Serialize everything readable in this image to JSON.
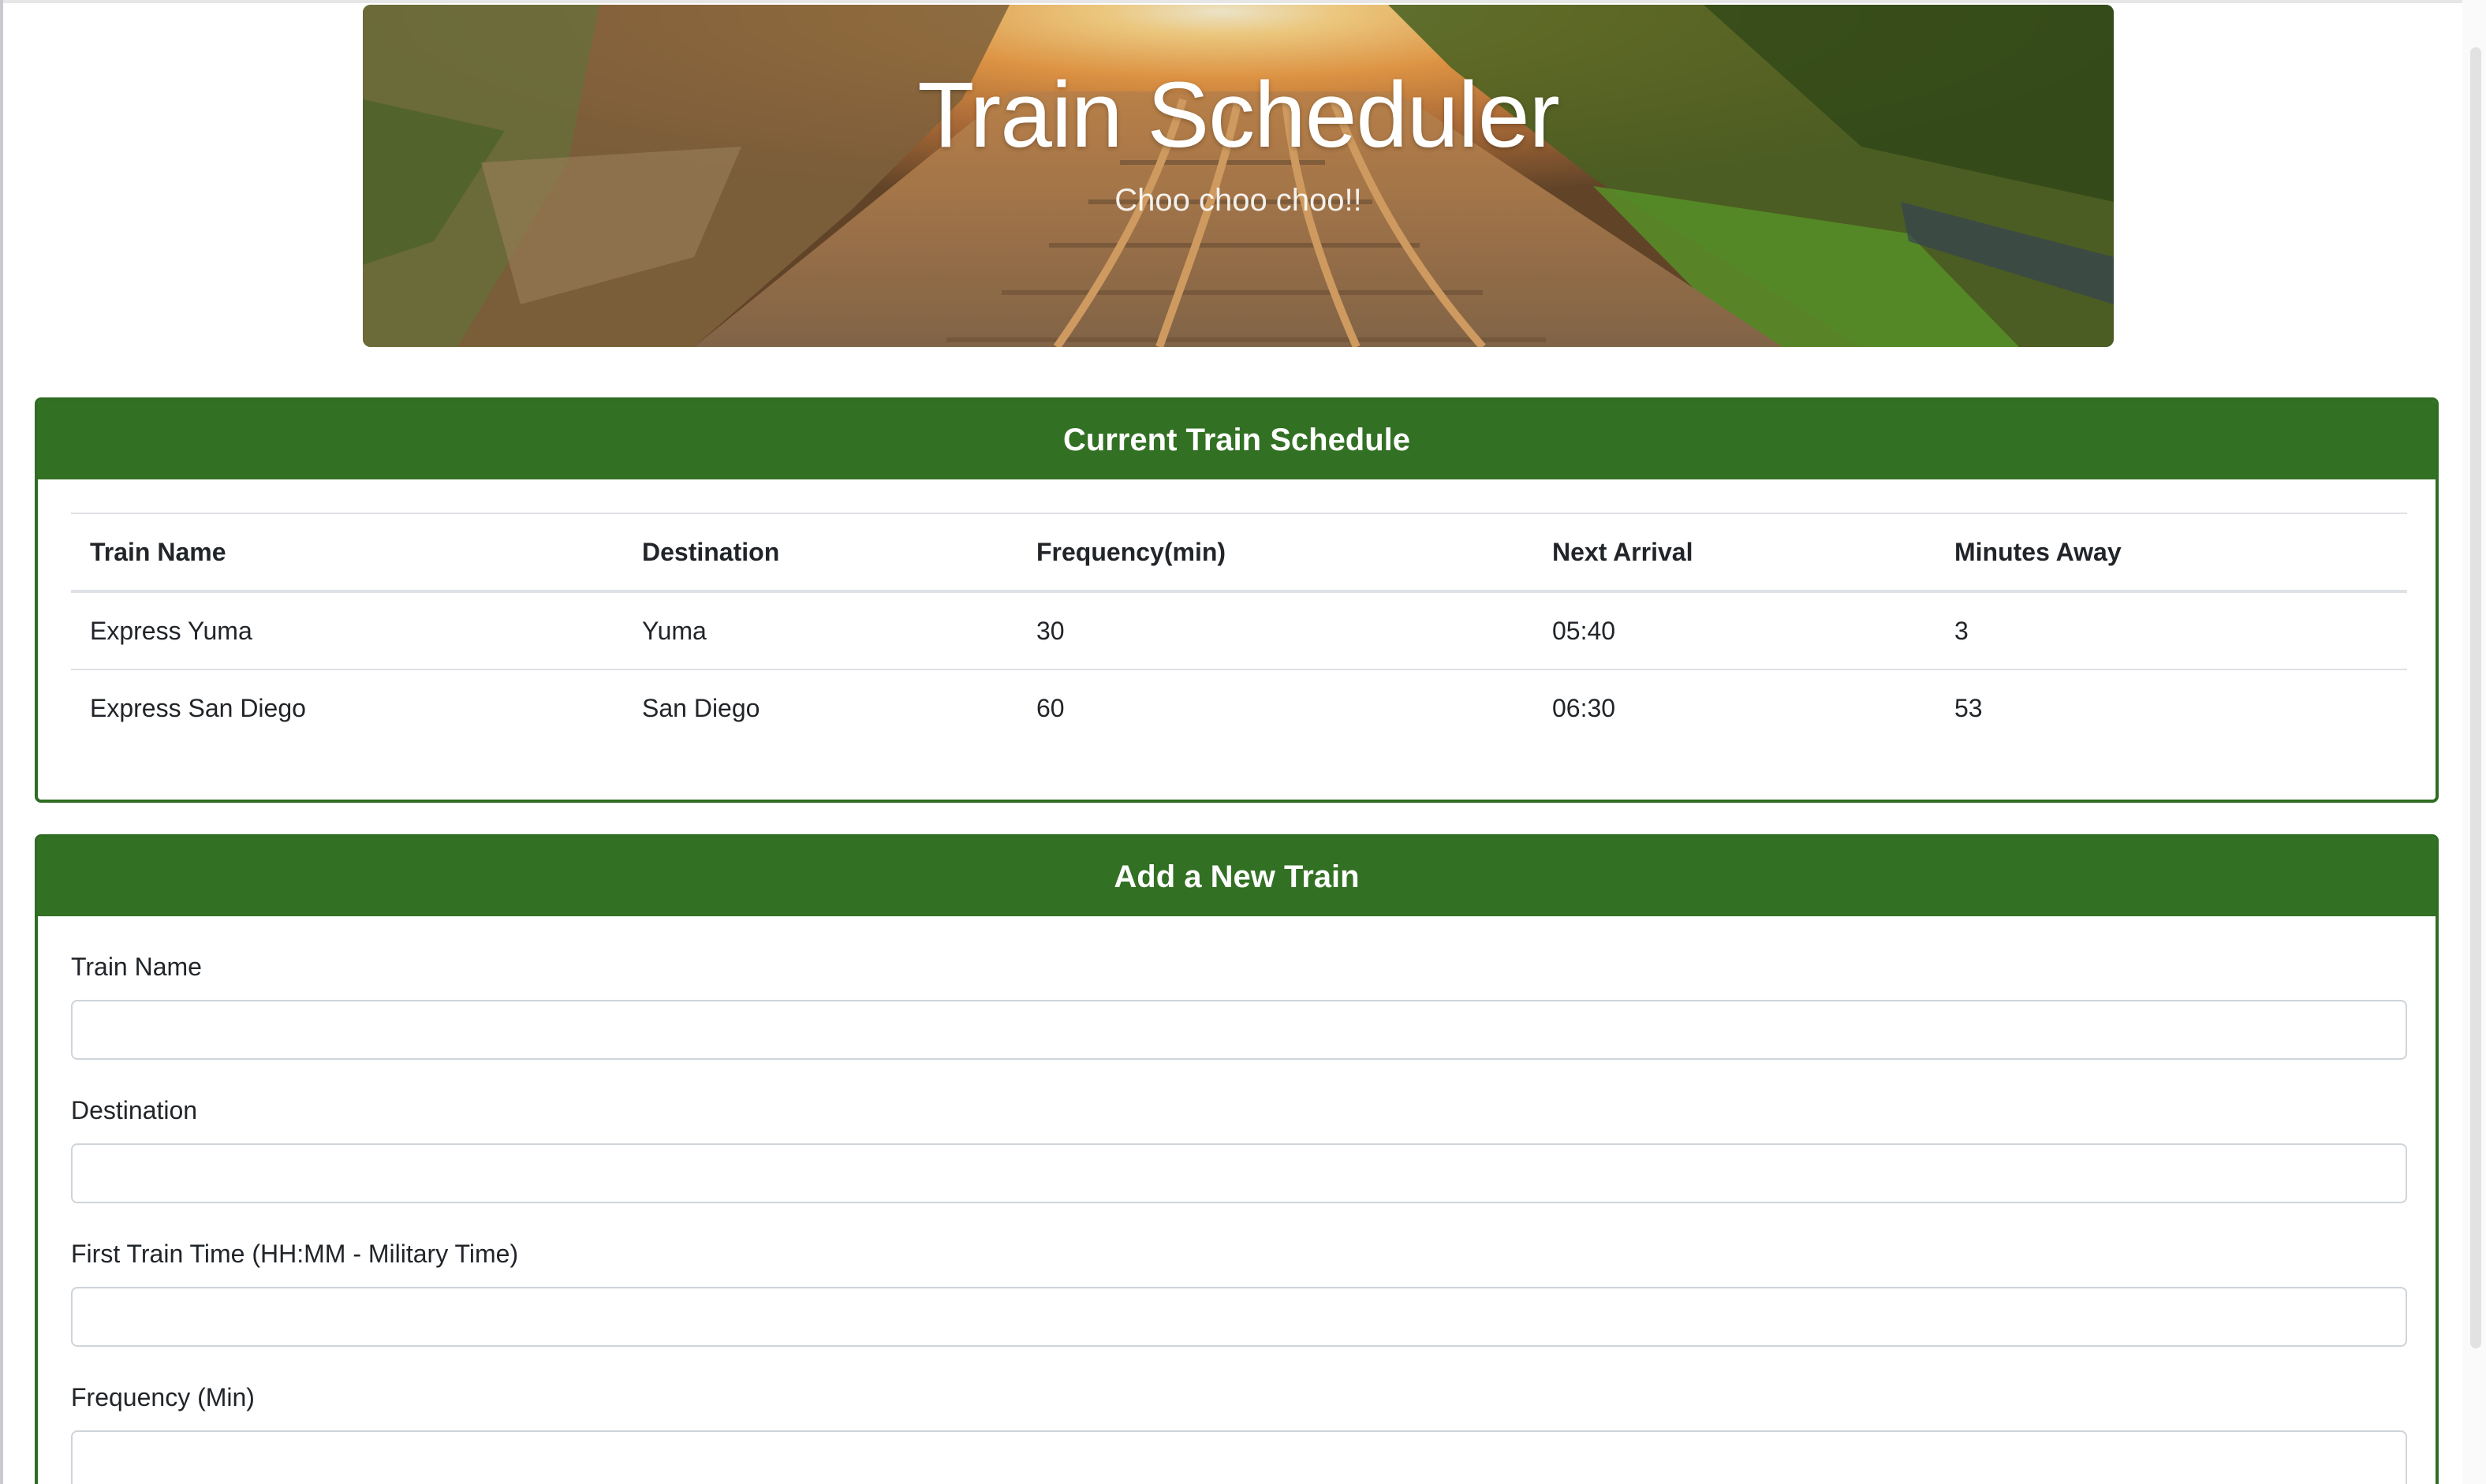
{
  "jumbotron": {
    "title": "Train Scheduler",
    "subtitle": "Choo choo choo!!"
  },
  "schedule": {
    "header": "Current Train Schedule",
    "columns": [
      "Train Name",
      "Destination",
      "Frequency(min)",
      "Next Arrival",
      "Minutes Away"
    ],
    "rows": [
      [
        "Express Yuma",
        "Yuma",
        "30",
        "05:40",
        "3"
      ],
      [
        "Express San Diego",
        "San Diego",
        "60",
        "06:30",
        "53"
      ]
    ]
  },
  "form": {
    "header": "Add a New Train",
    "fields": [
      {
        "label": "Train Name",
        "value": "",
        "placeholder": ""
      },
      {
        "label": "Destination",
        "value": "",
        "placeholder": ""
      },
      {
        "label": "First Train Time (HH:MM - Military Time)",
        "value": "",
        "placeholder": ""
      },
      {
        "label": "Frequency (Min)",
        "value": "",
        "placeholder": ""
      }
    ]
  },
  "colors": {
    "card_header": "#327023",
    "card_border": "#2f6d22"
  }
}
